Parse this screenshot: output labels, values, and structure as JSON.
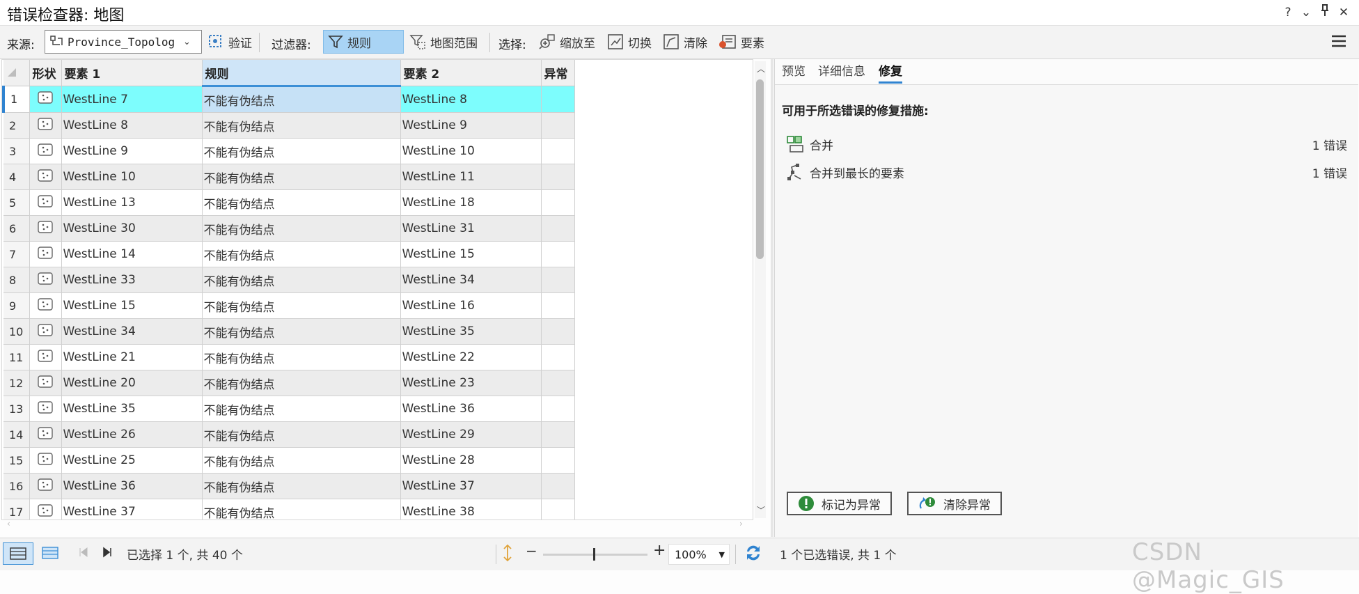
{
  "window": {
    "title": "错误检查器: 地图",
    "controls": [
      "?",
      "⌄",
      "⊻",
      "✕"
    ]
  },
  "toolbar": {
    "source_label": "来源:",
    "source_value": "Province_Topolog",
    "validate_label": "验证",
    "filter_label": "过滤器:",
    "rule_label": "规则",
    "map_extent_label": "地图范围",
    "select_label": "选择:",
    "zoom_to_label": "缩放至",
    "switch_label": "切换",
    "clear_label": "清除",
    "features_label": "要素"
  },
  "table": {
    "columns": [
      "形状",
      "要素 1",
      "规则",
      "要素 2",
      "异常"
    ],
    "rows": [
      {
        "num": "1",
        "f1": "WestLine 7",
        "rule": "不能有伪结点",
        "f2": "WestLine 8"
      },
      {
        "num": "2",
        "f1": "WestLine 8",
        "rule": "不能有伪结点",
        "f2": "WestLine 9"
      },
      {
        "num": "3",
        "f1": "WestLine 9",
        "rule": "不能有伪结点",
        "f2": "WestLine 10"
      },
      {
        "num": "4",
        "f1": "WestLine 10",
        "rule": "不能有伪结点",
        "f2": "WestLine 11"
      },
      {
        "num": "5",
        "f1": "WestLine 13",
        "rule": "不能有伪结点",
        "f2": "WestLine 18"
      },
      {
        "num": "6",
        "f1": "WestLine 30",
        "rule": "不能有伪结点",
        "f2": "WestLine 31"
      },
      {
        "num": "7",
        "f1": "WestLine 14",
        "rule": "不能有伪结点",
        "f2": "WestLine 15"
      },
      {
        "num": "8",
        "f1": "WestLine 33",
        "rule": "不能有伪结点",
        "f2": "WestLine 34"
      },
      {
        "num": "9",
        "f1": "WestLine 15",
        "rule": "不能有伪结点",
        "f2": "WestLine 16"
      },
      {
        "num": "10",
        "f1": "WestLine 34",
        "rule": "不能有伪结点",
        "f2": "WestLine 35"
      },
      {
        "num": "11",
        "f1": "WestLine 21",
        "rule": "不能有伪结点",
        "f2": "WestLine 22"
      },
      {
        "num": "12",
        "f1": "WestLine 20",
        "rule": "不能有伪结点",
        "f2": "WestLine 23"
      },
      {
        "num": "13",
        "f1": "WestLine 35",
        "rule": "不能有伪结点",
        "f2": "WestLine 36"
      },
      {
        "num": "14",
        "f1": "WestLine 26",
        "rule": "不能有伪结点",
        "f2": "WestLine 29"
      },
      {
        "num": "15",
        "f1": "WestLine 25",
        "rule": "不能有伪结点",
        "f2": "WestLine 28"
      },
      {
        "num": "16",
        "f1": "WestLine 36",
        "rule": "不能有伪结点",
        "f2": "WestLine 37"
      },
      {
        "num": "17",
        "f1": "WestLine 37",
        "rule": "不能有伪结点",
        "f2": "WestLine 38"
      }
    ],
    "selected_row": 0
  },
  "statusbar": {
    "selection_text": "已选择 1 个, 共 40 个",
    "zoom_value": "100%",
    "right_status": "1 个已选错误, 共 1 个"
  },
  "panel": {
    "tabs": [
      "预览",
      "详细信息",
      "修复"
    ],
    "active_tab": "修复",
    "heading": "可用于所选错误的修复措施:",
    "fixes": [
      {
        "label": "合并",
        "count": "1 错误"
      },
      {
        "label": "合并到最长的要素",
        "count": "1 错误"
      }
    ],
    "mark_exception_label": "标记为异常",
    "clear_exception_label": "清除异常"
  },
  "watermark": "CSDN @Magic_GIS",
  "colors": {
    "selected_row": "#7dfdfd",
    "accent": "#2f83d0",
    "filter_active": "#a9d4f5"
  }
}
